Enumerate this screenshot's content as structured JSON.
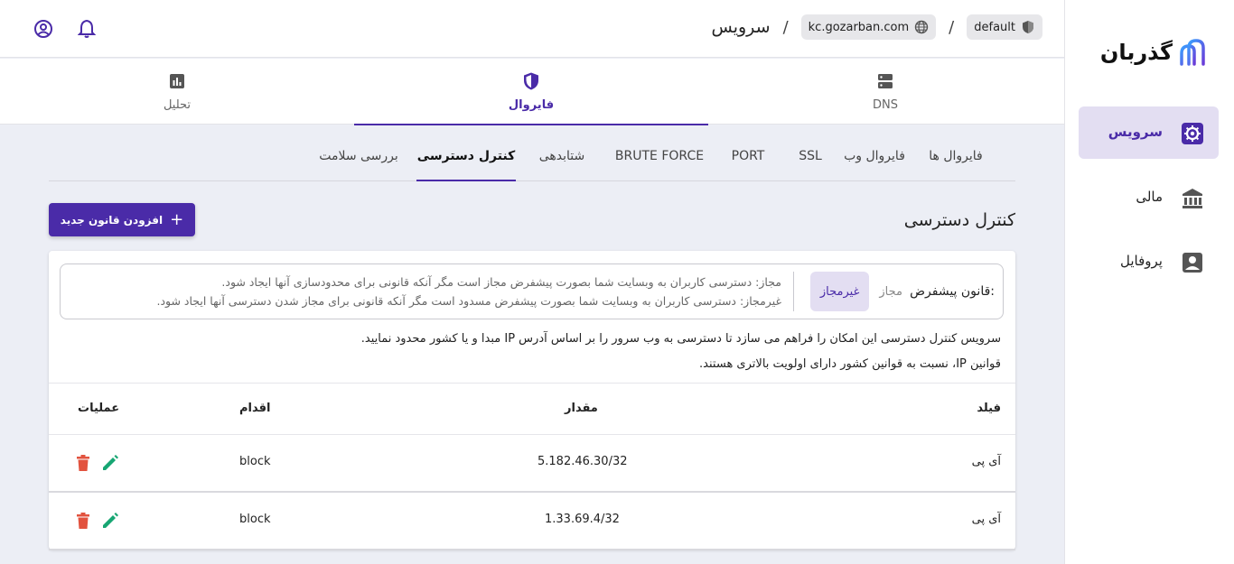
{
  "sidebar": {
    "logo_text": "گذربان",
    "items": [
      {
        "label": "سرویس",
        "icon": "settings-icon",
        "active": true
      },
      {
        "label": "مالی",
        "icon": "bank-icon",
        "active": false
      },
      {
        "label": "پروفایل",
        "icon": "profile-icon",
        "active": false
      }
    ]
  },
  "header": {
    "title": "سرویس",
    "separator": "/",
    "domain_chip": "kc.gozarban.com",
    "policy_chip": "default"
  },
  "main_tabs": [
    {
      "label": "DNS",
      "icon": "server-icon"
    },
    {
      "label": "فایروال",
      "icon": "shield-icon"
    },
    {
      "label": "تحلیل",
      "icon": "bar-chart-icon"
    }
  ],
  "sub_tabs": [
    "فایروال ها",
    "فایروال وب",
    "SSL",
    "PORT",
    "BRUTE FORCE",
    "شتابدهی",
    "کنترل دسترسی",
    "بررسی سلامت"
  ],
  "page": {
    "title": "کنترل دسترسی",
    "add_button": "افزودن قانون جدید"
  },
  "default_rule": {
    "label": "قانون پیشفرض:",
    "options": [
      "مجاز",
      "غیرمجاز"
    ],
    "selected": "غیرمجاز",
    "desc_allow": "مجاز: دسترسی کاربران به وبسایت شما بصورت پیشفرض مجاز است مگر آنکه قانونی برای محدودسازی آنها ایجاد شود.",
    "desc_deny": "غیرمجاز: دسترسی کاربران به وبسایت شما بصورت پیشفرض مسدود است مگر آنکه قانونی برای مجاز شدن دسترسی آنها ایجاد شود."
  },
  "info": {
    "line1": "سرویس کنترل دسترسی این امکان را فراهم می سازد تا دسترسی به وب سرور را بر اساس آدرس IP مبدا و یا کشور محدود نمایید.",
    "line2": "قوانین IP، نسبت به قوانین کشور دارای اولویت بالاتری هستند."
  },
  "table": {
    "headers": {
      "field": "فیلد",
      "value": "مقدار",
      "action": "اقدام",
      "ops": "عملیات"
    },
    "rows": [
      {
        "field": "آی پی",
        "value": "5.182.46.30/32",
        "action": "block"
      },
      {
        "field": "آی پی",
        "value": "1.33.69.4/32",
        "action": "block"
      }
    ]
  },
  "colors": {
    "accent": "#4a2ba8",
    "delete": "#e2533f",
    "edit": "#17a673"
  }
}
